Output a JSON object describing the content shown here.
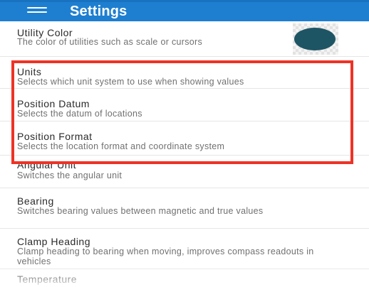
{
  "app_bar": {
    "title": "Settings",
    "menu_icon": "hamburger-menu-icon",
    "background": "#1e7fd0"
  },
  "settings": [
    {
      "id": "utility-color",
      "title": "Utility Color",
      "subtitle": "The color of utilities such as scale or cursors",
      "swatch_color": "#1e5565"
    },
    {
      "id": "units",
      "title": "Units",
      "subtitle": "Selects which unit system to use when showing values"
    },
    {
      "id": "position-datum",
      "title": "Position Datum",
      "subtitle": "Selects the datum of locations"
    },
    {
      "id": "position-format",
      "title": "Position Format",
      "subtitle": "Selects the location format and coordinate system"
    },
    {
      "id": "angular-unit",
      "title": "Angular Unit",
      "subtitle": "Switches the angular unit"
    },
    {
      "id": "bearing",
      "title": "Bearing",
      "subtitle": "Switches bearing values between magnetic and true values"
    },
    {
      "id": "clamp-heading",
      "title": "Clamp Heading",
      "subtitle": "Clamp heading to bearing when moving, improves compass readouts in vehicles"
    },
    {
      "id": "temperature",
      "title": "Temperature",
      "subtitle": ""
    }
  ],
  "highlight_color": "#ee3326"
}
